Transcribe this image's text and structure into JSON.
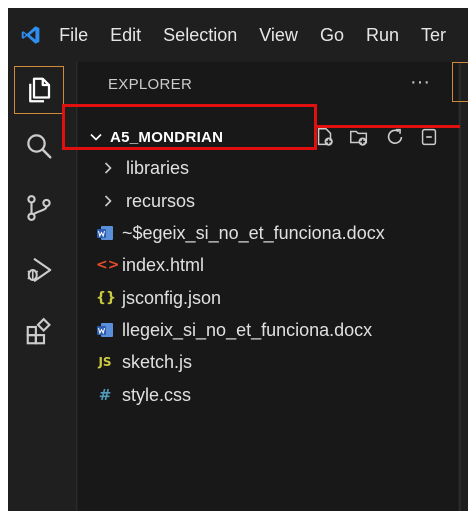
{
  "menu": {
    "items": [
      "File",
      "Edit",
      "Selection",
      "View",
      "Go",
      "Run",
      "Ter"
    ]
  },
  "activity": {
    "icons": [
      "explorer-icon",
      "search-icon",
      "source-control-icon",
      "run-debug-icon",
      "extensions-icon"
    ],
    "active": "explorer-icon"
  },
  "explorer": {
    "title": "EXPLORER",
    "more": "···",
    "folder": {
      "name": "A5_MONDRIAN",
      "tools": [
        "new-file-icon",
        "new-folder-icon",
        "refresh-icon",
        "collapse-all-icon"
      ]
    },
    "items": [
      {
        "label": "libraries",
        "type": "folder",
        "icon": "chevron-right-icon"
      },
      {
        "label": "recursos",
        "type": "folder",
        "icon": "chevron-right-icon"
      },
      {
        "label": "~$egeix_si_no_et_funciona.docx",
        "type": "docx",
        "icon": "word-icon"
      },
      {
        "label": "index.html",
        "type": "html",
        "icon": "html-icon",
        "glyph": "<>"
      },
      {
        "label": "jsconfig.json",
        "type": "json",
        "icon": "json-icon",
        "glyph": "{}"
      },
      {
        "label": "llegeix_si_no_et_funciona.docx",
        "type": "docx",
        "icon": "word-icon"
      },
      {
        "label": "sketch.js",
        "type": "js",
        "icon": "js-icon",
        "glyph": "JS"
      },
      {
        "label": "style.css",
        "type": "css",
        "icon": "css-icon",
        "glyph": "#"
      }
    ]
  },
  "colors": {
    "accent": "#d08a3a",
    "highlight": "#e01010",
    "html": "#e44d26",
    "json": "#cbcb41",
    "js": "#cbcb41",
    "css": "#519aba",
    "word": "#3b76c4",
    "vscode": "#2f8ff0"
  }
}
